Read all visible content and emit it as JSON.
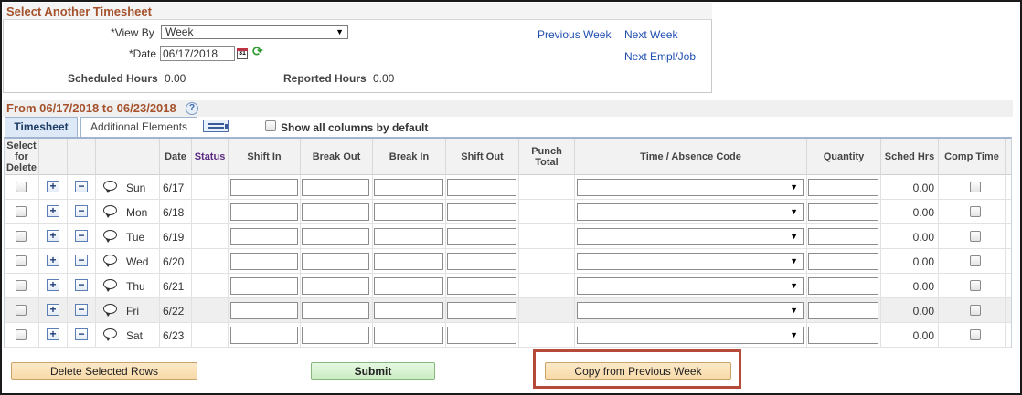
{
  "select_panel": {
    "title": "Select Another Timesheet",
    "view_by_label": "*View By",
    "view_by_value": "Week",
    "date_label": "*Date",
    "date_value": "06/17/2018",
    "scheduled_hours_label": "Scheduled Hours",
    "scheduled_hours_value": "0.00",
    "reported_hours_label": "Reported Hours",
    "reported_hours_value": "0.00",
    "prev_week_link": "Previous Week",
    "next_week_link": "Next Week",
    "next_empl_link": "Next Empl/Job",
    "calendar_icon_text": "31"
  },
  "timesheet": {
    "range_title": "From 06/17/2018 to 06/23/2018",
    "help_icon": "?",
    "tabs": [
      "Timesheet",
      "Additional Elements"
    ],
    "show_all_label": "Show all columns by default",
    "columns": {
      "select_for_delete": "Select for Delete",
      "date": "Date",
      "status": "Status",
      "shift_in": "Shift In",
      "break_out": "Break Out",
      "break_in": "Break In",
      "shift_out": "Shift Out",
      "punch_total": "Punch Total",
      "time_absence_code": "Time / Absence Code",
      "quantity": "Quantity",
      "sched_hrs": "Sched Hrs",
      "comp_time": "Comp Time"
    },
    "rows": [
      {
        "day": "Sun",
        "date": "6/17",
        "sched_hrs": "0.00"
      },
      {
        "day": "Mon",
        "date": "6/18",
        "sched_hrs": "0.00"
      },
      {
        "day": "Tue",
        "date": "6/19",
        "sched_hrs": "0.00"
      },
      {
        "day": "Wed",
        "date": "6/20",
        "sched_hrs": "0.00"
      },
      {
        "day": "Thu",
        "date": "6/21",
        "sched_hrs": "0.00"
      },
      {
        "day": "Fri",
        "date": "6/22",
        "sched_hrs": "0.00"
      },
      {
        "day": "Sat",
        "date": "6/23",
        "sched_hrs": "0.00"
      }
    ],
    "add_symbol": "+",
    "remove_symbol": "−"
  },
  "actions": {
    "delete_rows": "Delete Selected Rows",
    "submit": "Submit",
    "copy_previous": "Copy from Previous Week"
  },
  "colors": {
    "section_title": "#a5522c",
    "link": "#1f4fb0",
    "highlight": "#b5493a"
  },
  "icons": {
    "calendar": "calendar-icon",
    "refresh": "refresh-icon",
    "help": "help-icon",
    "grid_settings": "grid-settings-icon",
    "comment": "comment-bubble-icon"
  }
}
